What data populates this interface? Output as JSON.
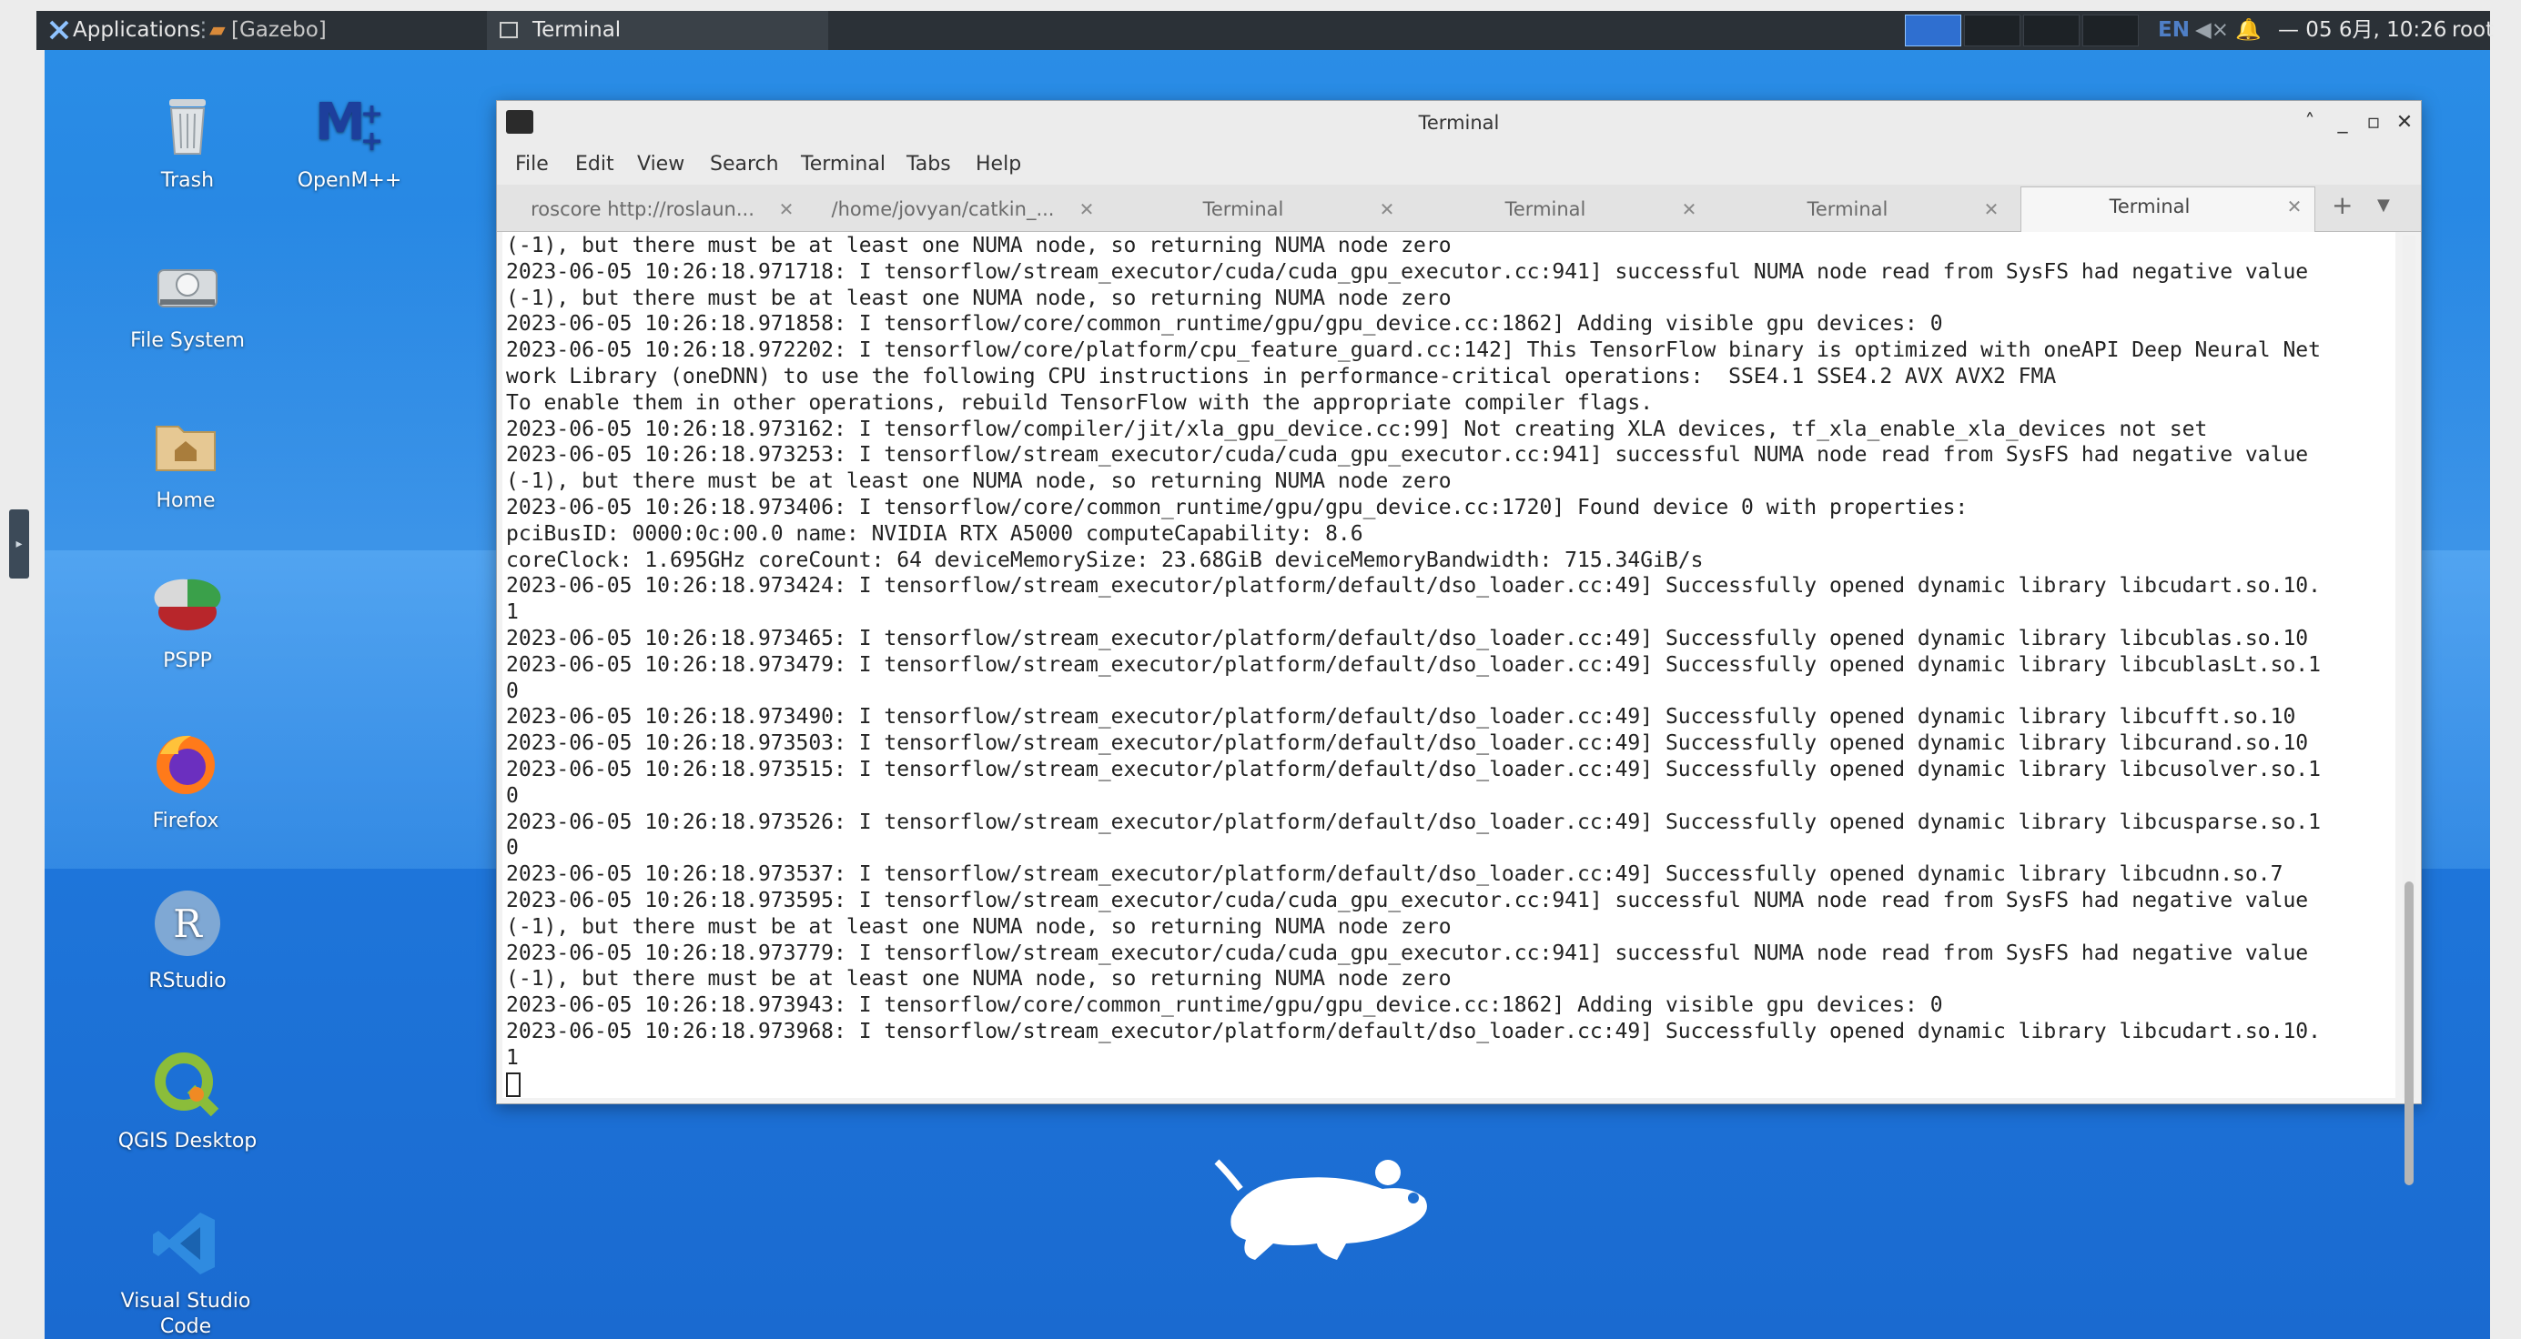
{
  "panel": {
    "applications": "Applications",
    "tasks": [
      "[Gazebo]",
      "Terminal"
    ],
    "language": "EN",
    "clock": "— 05 6月, 10:26",
    "user": "root"
  },
  "desktop_icons": [
    {
      "label": "Trash",
      "icon": "trash-icon"
    },
    {
      "label": "OpenM++",
      "icon": "openm-icon"
    },
    {
      "label": "File System",
      "icon": "drive-icon"
    },
    {
      "label": "Home",
      "icon": "home-folder-icon"
    },
    {
      "label": "PSPP",
      "icon": "pspp-icon"
    },
    {
      "label": "Firefox",
      "icon": "firefox-icon"
    },
    {
      "label": "RStudio",
      "icon": "rstudio-icon"
    },
    {
      "label": "QGIS Desktop",
      "icon": "qgis-icon"
    },
    {
      "label": "Visual Studio Code",
      "icon": "vscode-icon"
    }
  ],
  "window": {
    "title": "Terminal",
    "menu": [
      "File",
      "Edit",
      "View",
      "Search",
      "Terminal",
      "Tabs",
      "Help"
    ],
    "tabs": [
      {
        "label": "roscore http://roslaun..."
      },
      {
        "label": "/home/jovyan/catkin_..."
      },
      {
        "label": "Terminal"
      },
      {
        "label": "Terminal"
      },
      {
        "label": "Terminal"
      },
      {
        "label": "Terminal"
      }
    ],
    "lines": [
      "(-1), but there must be at least one NUMA node, so returning NUMA node zero",
      "2023-06-05 10:26:18.971718: I tensorflow/stream_executor/cuda/cuda_gpu_executor.cc:941] successful NUMA node read from SysFS had negative value",
      "(-1), but there must be at least one NUMA node, so returning NUMA node zero",
      "2023-06-05 10:26:18.971858: I tensorflow/core/common_runtime/gpu/gpu_device.cc:1862] Adding visible gpu devices: 0",
      "2023-06-05 10:26:18.972202: I tensorflow/core/platform/cpu_feature_guard.cc:142] This TensorFlow binary is optimized with oneAPI Deep Neural Net",
      "work Library (oneDNN) to use the following CPU instructions in performance-critical operations:  SSE4.1 SSE4.2 AVX AVX2 FMA",
      "To enable them in other operations, rebuild TensorFlow with the appropriate compiler flags.",
      "2023-06-05 10:26:18.973162: I tensorflow/compiler/jit/xla_gpu_device.cc:99] Not creating XLA devices, tf_xla_enable_xla_devices not set",
      "2023-06-05 10:26:18.973253: I tensorflow/stream_executor/cuda/cuda_gpu_executor.cc:941] successful NUMA node read from SysFS had negative value",
      "(-1), but there must be at least one NUMA node, so returning NUMA node zero",
      "2023-06-05 10:26:18.973406: I tensorflow/core/common_runtime/gpu/gpu_device.cc:1720] Found device 0 with properties:",
      "pciBusID: 0000:0c:00.0 name: NVIDIA RTX A5000 computeCapability: 8.6",
      "coreClock: 1.695GHz coreCount: 64 deviceMemorySize: 23.68GiB deviceMemoryBandwidth: 715.34GiB/s",
      "2023-06-05 10:26:18.973424: I tensorflow/stream_executor/platform/default/dso_loader.cc:49] Successfully opened dynamic library libcudart.so.10.",
      "1",
      "2023-06-05 10:26:18.973465: I tensorflow/stream_executor/platform/default/dso_loader.cc:49] Successfully opened dynamic library libcublas.so.10",
      "2023-06-05 10:26:18.973479: I tensorflow/stream_executor/platform/default/dso_loader.cc:49] Successfully opened dynamic library libcublasLt.so.1",
      "0",
      "2023-06-05 10:26:18.973490: I tensorflow/stream_executor/platform/default/dso_loader.cc:49] Successfully opened dynamic library libcufft.so.10",
      "2023-06-05 10:26:18.973503: I tensorflow/stream_executor/platform/default/dso_loader.cc:49] Successfully opened dynamic library libcurand.so.10",
      "2023-06-05 10:26:18.973515: I tensorflow/stream_executor/platform/default/dso_loader.cc:49] Successfully opened dynamic library libcusolver.so.1",
      "0",
      "2023-06-05 10:26:18.973526: I tensorflow/stream_executor/platform/default/dso_loader.cc:49] Successfully opened dynamic library libcusparse.so.1",
      "0",
      "2023-06-05 10:26:18.973537: I tensorflow/stream_executor/platform/default/dso_loader.cc:49] Successfully opened dynamic library libcudnn.so.7",
      "2023-06-05 10:26:18.973595: I tensorflow/stream_executor/cuda/cuda_gpu_executor.cc:941] successful NUMA node read from SysFS had negative value",
      "(-1), but there must be at least one NUMA node, so returning NUMA node zero",
      "2023-06-05 10:26:18.973779: I tensorflow/stream_executor/cuda/cuda_gpu_executor.cc:941] successful NUMA node read from SysFS had negative value",
      "(-1), but there must be at least one NUMA node, so returning NUMA node zero",
      "2023-06-05 10:26:18.973943: I tensorflow/core/common_runtime/gpu/gpu_device.cc:1862] Adding visible gpu devices: 0",
      "2023-06-05 10:26:18.973968: I tensorflow/stream_executor/platform/default/dso_loader.cc:49] Successfully opened dynamic library libcudart.so.10.",
      "1"
    ]
  },
  "colors": {
    "desktop": "#1f78dc",
    "panel": "#2b3137",
    "terminal_bg": "#ffffff"
  }
}
